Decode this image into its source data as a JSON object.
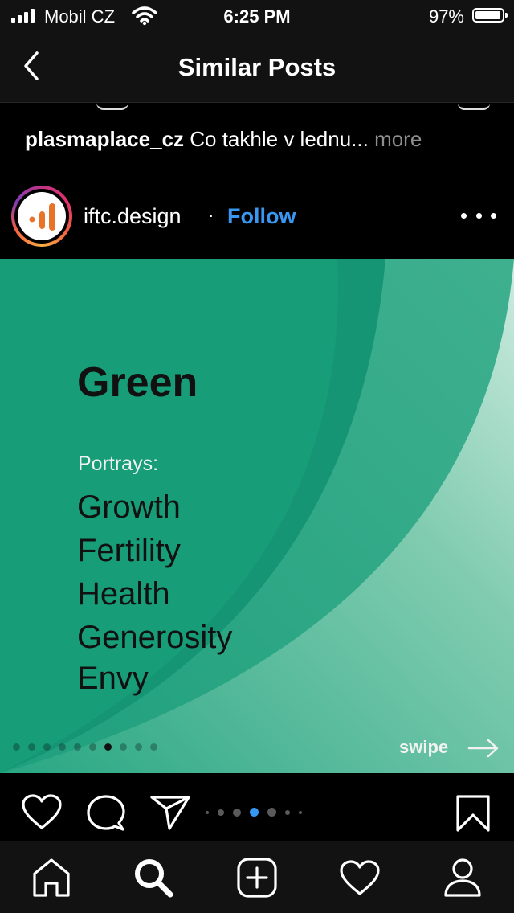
{
  "status_bar": {
    "carrier": "Mobil CZ",
    "time": "6:25 PM",
    "battery_percent": "97%",
    "battery_level": 0.97
  },
  "header": {
    "title": "Similar Posts",
    "back_icon": "chevron-left-icon"
  },
  "previous_post": {
    "username": "plasmaplace_cz",
    "caption": "Co takhle v lednu...",
    "more_label": "more"
  },
  "post": {
    "username": "iftc.design",
    "separator": "·",
    "follow_label": "Follow",
    "options_icon": "more-horizontal-icon",
    "image": {
      "heading": "Green",
      "subheading": "Portrays:",
      "traits": [
        "Growth",
        "Fertility",
        "Health",
        "Generosity",
        "Envy"
      ],
      "swipe_label": "swipe",
      "slide_count": 10,
      "active_slide_index": 6,
      "colors": {
        "background": "#179d78",
        "text_dark": "#111111"
      }
    },
    "actions": {
      "like_icon": "heart-icon",
      "comment_icon": "comment-icon",
      "share_icon": "paper-plane-icon",
      "save_icon": "bookmark-icon",
      "carousel_count": 7,
      "carousel_active_index": 4
    }
  },
  "tab_bar": {
    "items": [
      "home-icon",
      "search-icon",
      "new-post-icon",
      "activity-heart-icon",
      "profile-icon"
    ],
    "active": "search-icon"
  },
  "colors": {
    "accent_blue": "#3897f0",
    "background": "#000000",
    "bar": "#121212",
    "muted_text": "#8e8e8e"
  }
}
